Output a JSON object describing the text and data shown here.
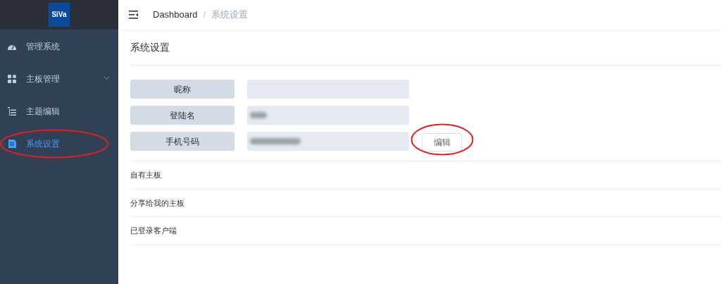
{
  "logo": {
    "text": "SiVa"
  },
  "sidebar": {
    "items": [
      {
        "label": "管理系统",
        "kind": "gauge",
        "selected": false,
        "circled": false,
        "expandable": false
      },
      {
        "label": "主板管理",
        "kind": "grid",
        "selected": false,
        "circled": false,
        "expandable": true
      },
      {
        "label": "主题编辑",
        "kind": "list",
        "selected": false,
        "circled": false,
        "expandable": false
      },
      {
        "label": "系统设置",
        "kind": "doc",
        "selected": true,
        "circled": true,
        "expandable": false
      }
    ]
  },
  "breadcrumb_separator": "/",
  "breadcrumb": [
    {
      "label": "Dashboard",
      "current": false
    },
    {
      "label": "系统设置",
      "current": true
    }
  ],
  "page_title": "系统设置",
  "form": [
    {
      "label": "昵称",
      "blurred": false
    },
    {
      "label": "登陆名",
      "blurred": true
    },
    {
      "label": "手机号码",
      "blurred": true,
      "button": {
        "label": "编辑",
        "circled": true
      }
    }
  ],
  "sections": [
    "自有主板",
    "分享给我的主板",
    "已登录客户端"
  ]
}
